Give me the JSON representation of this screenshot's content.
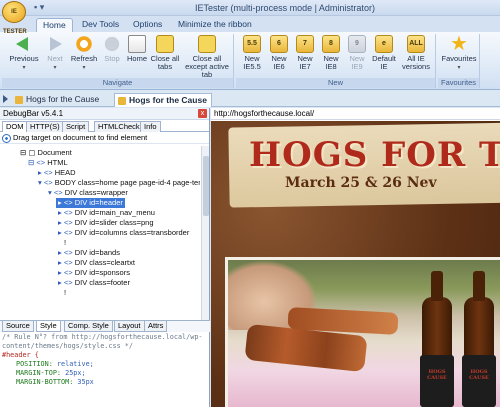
{
  "window": {
    "title": "IETester (multi-process mode | Administrator)",
    "app_icon_text": "IE TESTER"
  },
  "ribbon_tabs": [
    {
      "label": "Home",
      "active": true
    },
    {
      "label": "Dev Tools",
      "active": false
    },
    {
      "label": "Options",
      "active": false
    },
    {
      "label": "Minimize the ribbon",
      "active": false
    }
  ],
  "ribbon": {
    "navigate": {
      "group_label": "Navigate",
      "previous": "Previous",
      "next": "Next",
      "refresh": "Refresh",
      "stop": "Stop",
      "home": "Home",
      "close_all_tabs": "Close all tabs",
      "close_all_except": "Close all except active tab"
    },
    "new": {
      "group_label": "New",
      "ie55": "New IE5.5",
      "ie6": "New IE6",
      "ie7": "New IE7",
      "ie8": "New IE8",
      "ie9": "New IE9",
      "default_ie": "Default IE",
      "all_ie": "All IE versions",
      "icons": {
        "ie55": "5.5",
        "ie6": "6",
        "ie7": "7",
        "ie8": "8",
        "ie9": "9",
        "all": "ALL"
      }
    },
    "favorites": {
      "group_label": "Favourites",
      "button": "Favourites"
    }
  },
  "doc_tabs": [
    {
      "label": "Hogs for the Cause",
      "active": false
    },
    {
      "label": "Hogs for the Cause",
      "active": true
    }
  ],
  "debugbar": {
    "title": "DebugBar v5.4.1",
    "close": "x",
    "tabs": [
      "DOM",
      "HTTP(S)",
      "Script",
      "HTMLCheck",
      "Info"
    ],
    "drag_hint": "Drag target on document to find element",
    "tree": [
      {
        "text": "Document",
        "tag": false
      },
      {
        "text": "HTML",
        "tag": true
      },
      {
        "text": "HEAD",
        "tag": true
      },
      {
        "text": "BODY class=home page page-id-4 page-tem",
        "tag": true
      },
      {
        "text": "DIV class=wrapper",
        "tag": true
      },
      {
        "text": "DIV id=header",
        "tag": true
      },
      {
        "text": "DIV id=main_nav_menu",
        "tag": true
      },
      {
        "text": "DIV id=slider class=png",
        "tag": true
      },
      {
        "text": "DIV id=columns class=transborder",
        "tag": true
      },
      {
        "text": "!",
        "tag": false
      },
      {
        "text": "DIV id=bands",
        "tag": true
      },
      {
        "text": "DIV class=cleartxt",
        "tag": true
      },
      {
        "text": "DIV id=sponsors",
        "tag": true
      },
      {
        "text": "DIV class=footer",
        "tag": true
      },
      {
        "text": "!",
        "tag": false
      }
    ],
    "lower_tabs": [
      "Source",
      "Style",
      "Comp. Style",
      "Layout",
      "Attrs"
    ],
    "css": {
      "comment": "/* Rule N°? from http://hogsforthecause.local/wp-content/themes/hogs/style.css */",
      "selector": "#header {",
      "rules": [
        {
          "prop": "POSITION:",
          "val": "relative;"
        },
        {
          "prop": "MARGIN-TOP:",
          "val": "25px;"
        },
        {
          "prop": "MARGIN-BOTTOM:",
          "val": "35px"
        }
      ]
    }
  },
  "browser": {
    "url": "http://hogsforthecause.local/",
    "site_title": "HOGS FOR TH",
    "site_date": "March 25 & 26 Nev",
    "koozie_text": "HOGS CAUSE"
  }
}
